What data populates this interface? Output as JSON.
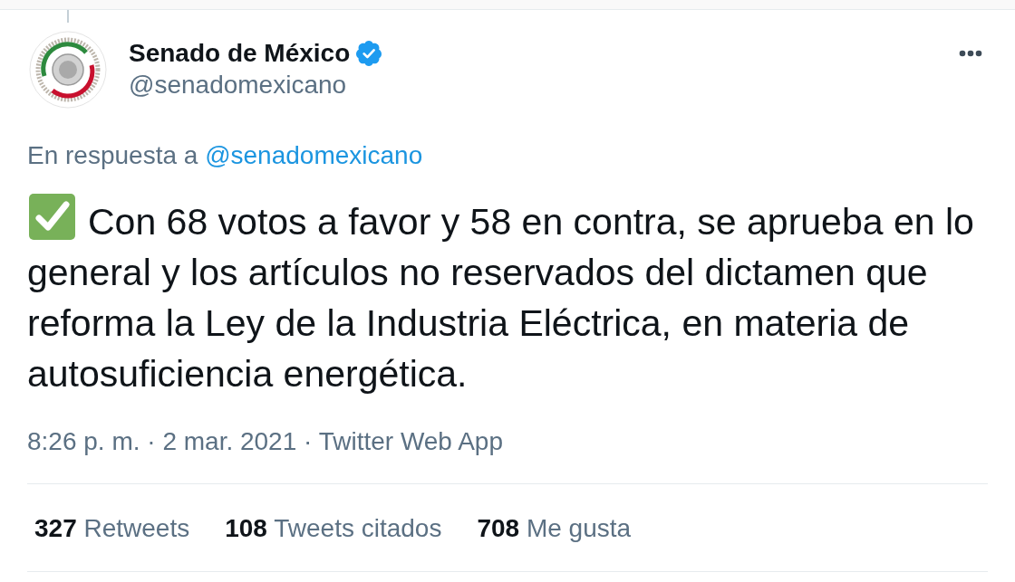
{
  "tweet": {
    "author": {
      "name": "Senado de México",
      "verified": true,
      "handle": "@senadomexicano"
    },
    "reply_to": {
      "prefix": "En respuesta a",
      "handle": "@senadomexicano"
    },
    "text": "Con 68 votos a favor y 58 en contra, se aprueba en lo general y los artículos no reservados del dictamen que reforma la Ley de la Industria Eléctrica, en materia de autosuficiencia energética.",
    "meta": "8:26 p. m. · 2 mar. 2021 · Twitter Web App",
    "stats": [
      {
        "count": "327",
        "label": "Retweets"
      },
      {
        "count": "108",
        "label": "Tweets citados"
      },
      {
        "count": "708",
        "label": "Me gusta"
      }
    ]
  }
}
